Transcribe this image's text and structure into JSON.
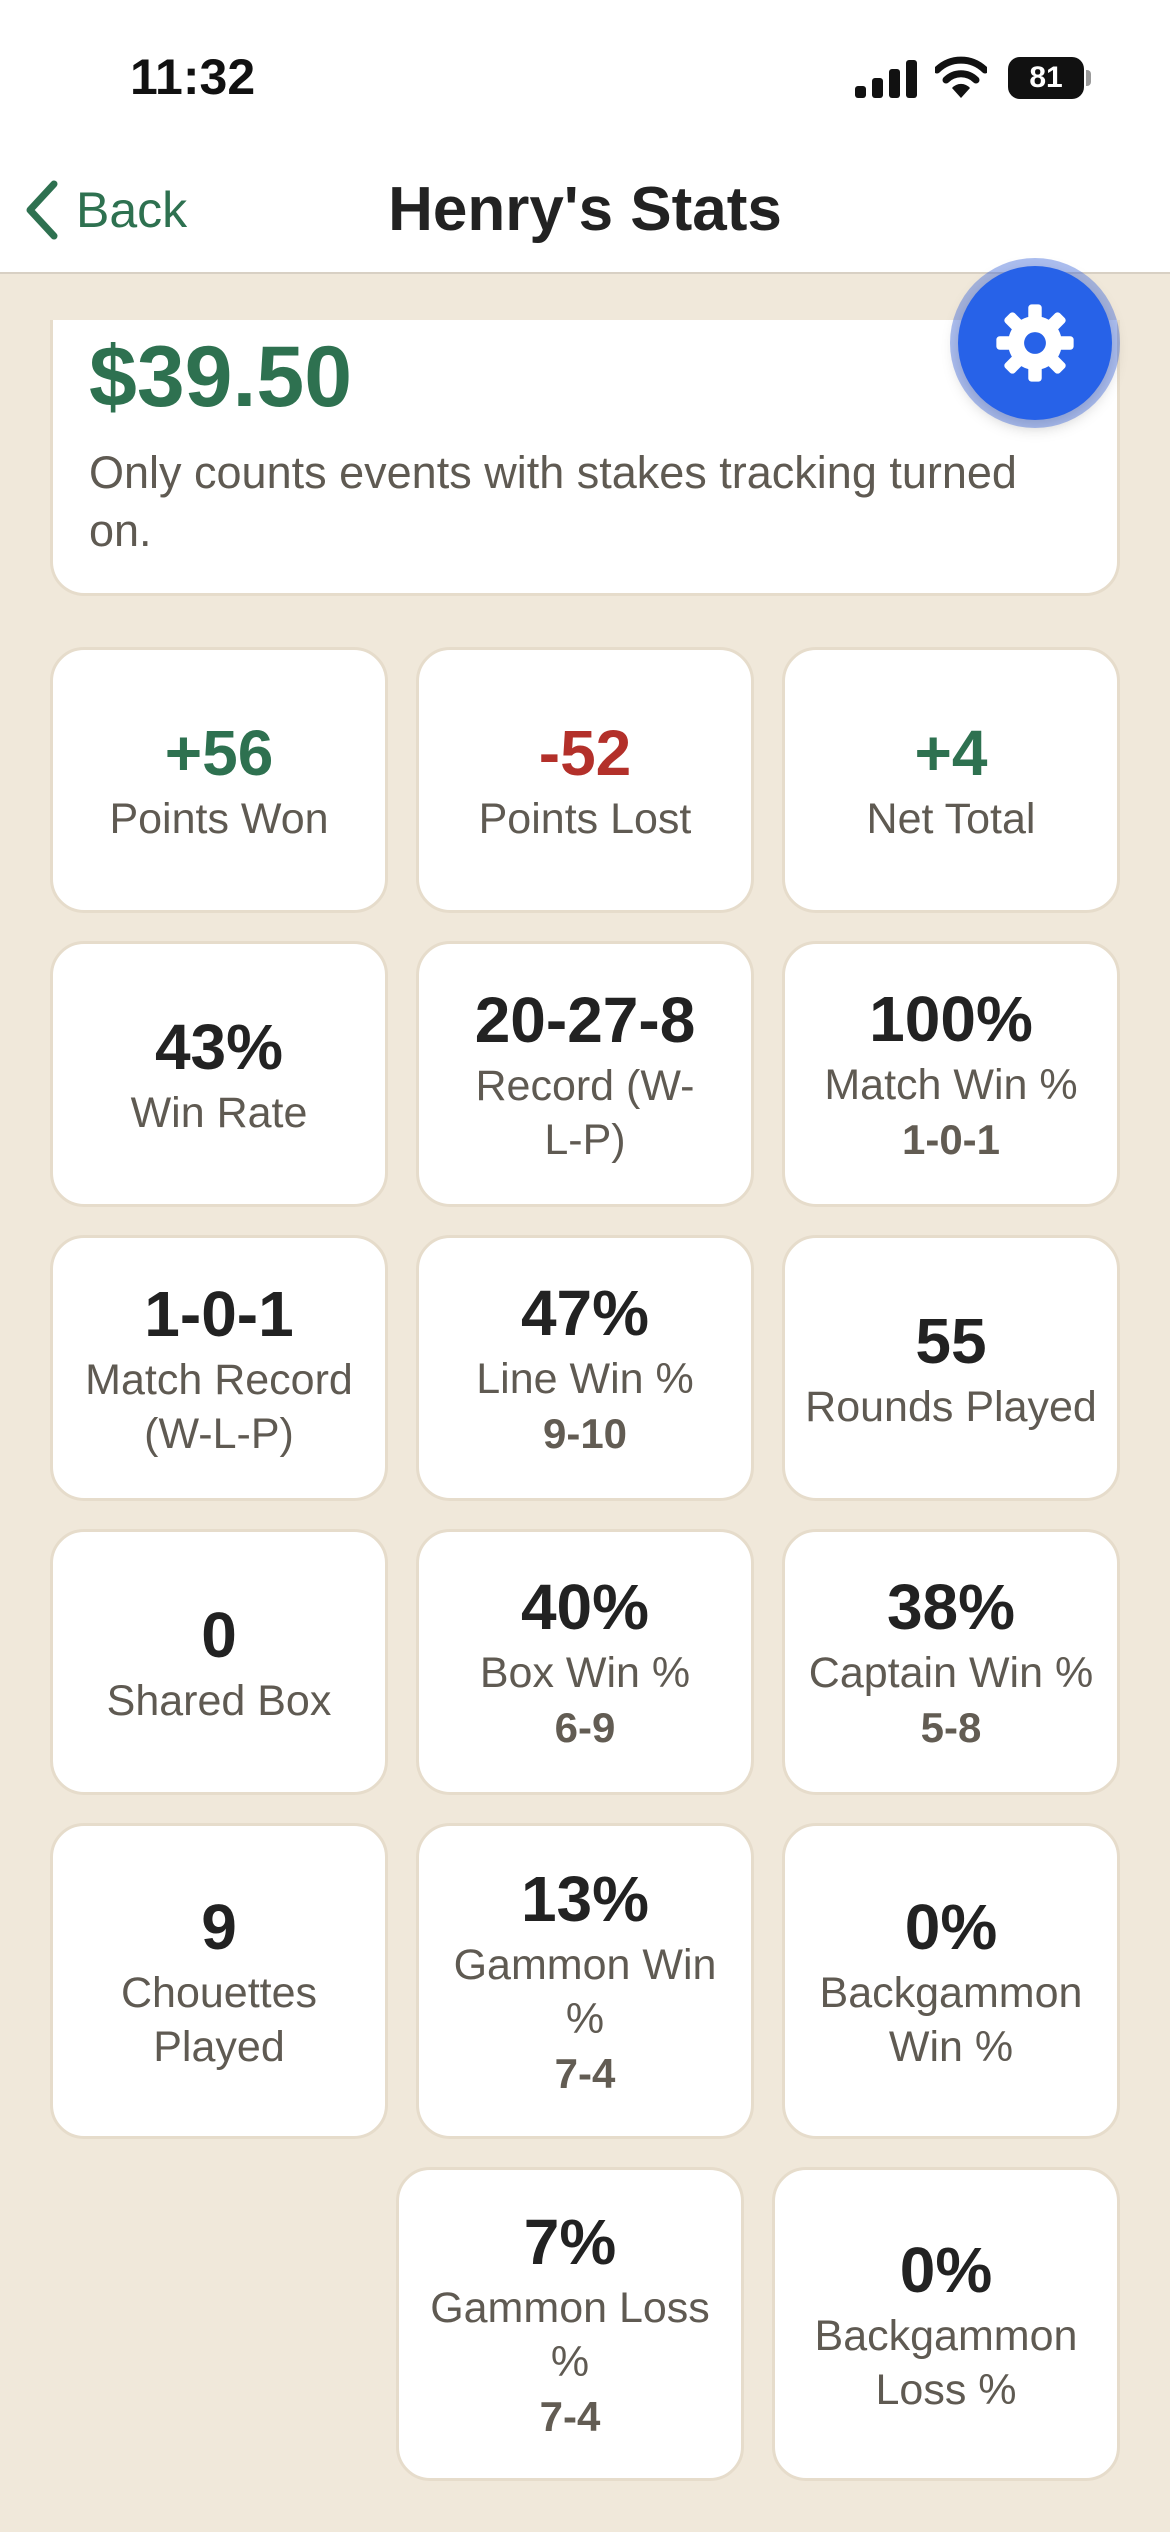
{
  "status_bar": {
    "time": "11:32",
    "battery": "81",
    "icons": [
      "signal-icon",
      "wifi-icon",
      "battery-icon"
    ]
  },
  "nav": {
    "back_label": "Back",
    "title": "Henry's Stats"
  },
  "summary": {
    "amount": "$39.50",
    "note": "Only counts events with stakes tracking turned on."
  },
  "colors": {
    "positive": "#2e7150",
    "negative": "#b3302a",
    "fab": "#2762e8",
    "background": "#f0e8da"
  },
  "stats": {
    "points_won": {
      "value": "+56",
      "label": "Points Won"
    },
    "points_lost": {
      "value": "-52",
      "label": "Points Lost"
    },
    "net_total": {
      "value": "+4",
      "label": "Net Total"
    },
    "win_rate": {
      "value": "43%",
      "label": "Win Rate"
    },
    "record": {
      "value": "20-27-8",
      "label": "Record (W-L-P)"
    },
    "match_win_pct": {
      "value": "100%",
      "label": "Match Win %",
      "sub": "1-0-1"
    },
    "match_record": {
      "value": "1-0-1",
      "label": "Match Record (W-L-P)"
    },
    "line_win_pct": {
      "value": "47%",
      "label": "Line Win %",
      "sub": "9-10"
    },
    "rounds_played": {
      "value": "55",
      "label": "Rounds Played"
    },
    "shared_box": {
      "value": "0",
      "label": "Shared Box"
    },
    "box_win_pct": {
      "value": "40%",
      "label": "Box Win %",
      "sub": "6-9"
    },
    "captain_win_pct": {
      "value": "38%",
      "label": "Captain Win %",
      "sub": "5-8"
    },
    "chouettes_played": {
      "value": "9",
      "label": "Chouettes Played"
    },
    "gammon_win_pct": {
      "value": "13%",
      "label": "Gammon Win %",
      "sub": "7-4"
    },
    "backgammon_win_pct": {
      "value": "0%",
      "label": "Backgammon Win %"
    },
    "gammon_loss_pct": {
      "value": "7%",
      "label": "Gammon Loss %",
      "sub": "7-4"
    },
    "backgammon_loss_pct": {
      "value": "0%",
      "label": "Backgammon Loss %"
    }
  }
}
